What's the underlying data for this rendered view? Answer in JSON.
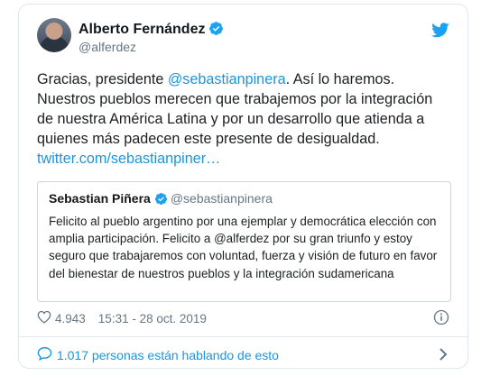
{
  "author": {
    "name": "Alberto Fernández",
    "handle": "@alferdez"
  },
  "tweet": {
    "text_before": "Gracias, presidente ",
    "mention": "@sebastianpinera",
    "text_after": ". Así lo haremos. Nuestros pueblos merecen que trabajemos por la integración de nuestra América Latina y por un desarrollo que atienda a quienes más padecen este presente de desigualdad.",
    "link": "twitter.com/sebastianpiner…"
  },
  "quoted": {
    "name": "Sebastian Piñera",
    "handle": "@sebastianpinera",
    "text": "Felicito al pueblo argentino por una ejemplar y democrática elección con amplia participación. Felicito a @alferdez por su gran triunfo y estoy seguro que trabajaremos con voluntad, fuerza y visión de futuro en favor del bienestar de nuestros pueblos y la integración sudamericana"
  },
  "meta": {
    "likes": "4.943",
    "timestamp": "15:31 - 28 oct. 2019"
  },
  "footer": {
    "conversation": "1.017 personas están hablando de esto"
  },
  "colors": {
    "link": "#1b95e0",
    "verified": "#1da1f2",
    "muted": "#657786",
    "border": "#e1e8ed"
  },
  "icons": [
    "twitter-bird-icon",
    "verified-badge-icon",
    "heart-icon",
    "info-icon",
    "speech-bubble-icon",
    "chevron-right-icon"
  ]
}
